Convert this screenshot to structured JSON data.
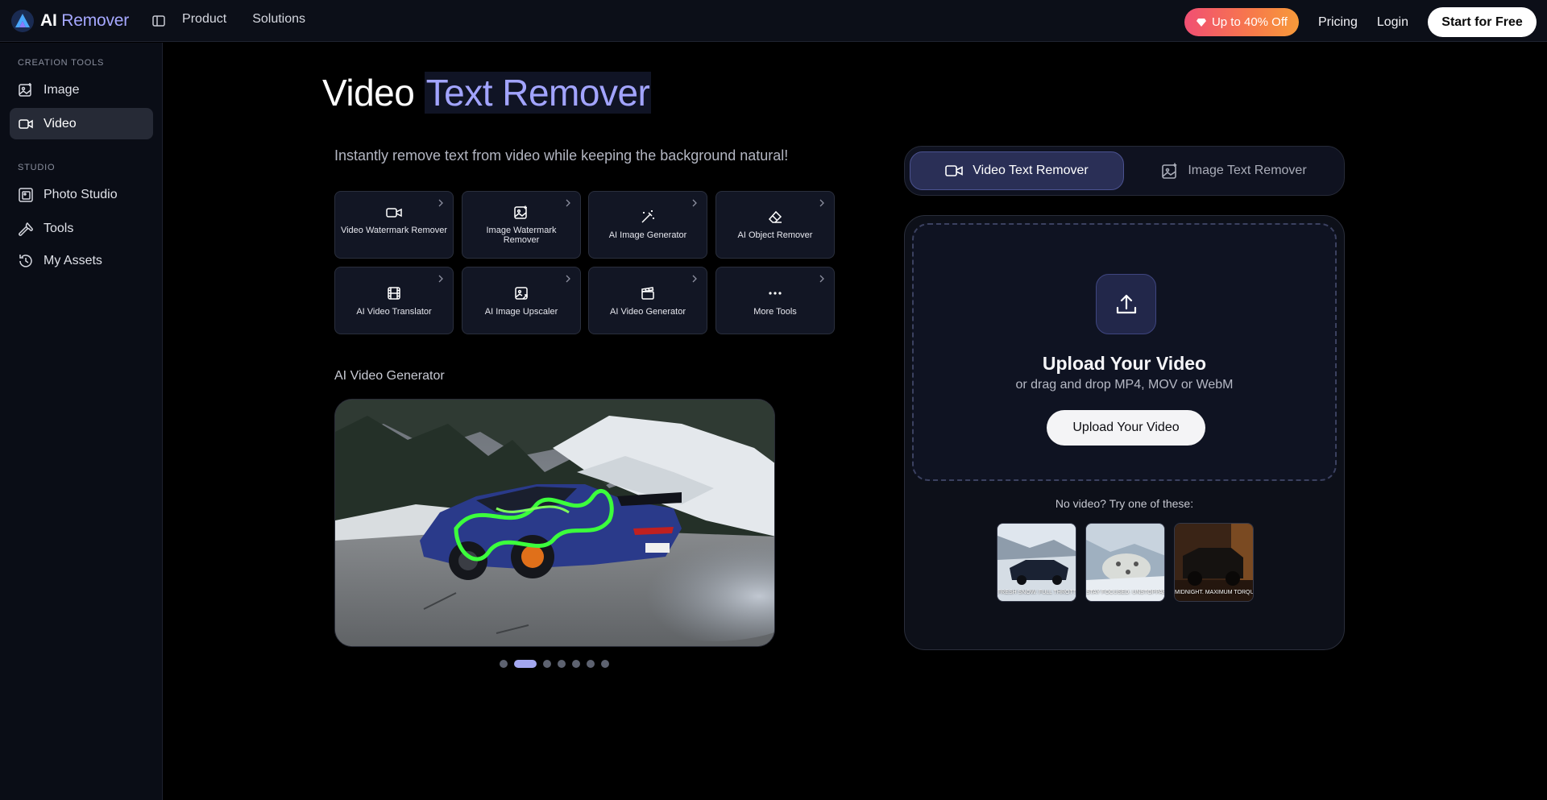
{
  "header": {
    "logo": {
      "ai": "AI",
      "remover": "Remover"
    },
    "nav": [
      "Product",
      "Solutions"
    ],
    "promo_label": "Up to 40% Off",
    "pricing_label": "Pricing",
    "login_label": "Login",
    "cta_label": "Start for Free"
  },
  "sidebar": {
    "section_creation": "CREATION TOOLS",
    "item_image": "Image",
    "item_video": "Video",
    "section_studio": "STUDIO",
    "item_photo_studio": "Photo Studio",
    "item_tools": "Tools",
    "item_assets": "My Assets",
    "active_item": "Video"
  },
  "main": {
    "title_part1": "Video",
    "title_accent": "Text Remover",
    "subtitle": "Instantly remove text from video while keeping the background natural!",
    "tools": [
      {
        "label": "Video Watermark Remover",
        "icon": "video-camera-icon"
      },
      {
        "label": "Image Watermark Remover",
        "icon": "image-icon"
      },
      {
        "label": "AI Image Generator",
        "icon": "magic-wand-icon"
      },
      {
        "label": "AI Object Remover",
        "icon": "eraser-icon"
      },
      {
        "label": "AI Video Translator",
        "icon": "film-icon"
      },
      {
        "label": "AI Image Upscaler",
        "icon": "image-upscale-icon"
      },
      {
        "label": "AI Video Generator",
        "icon": "clapperboard-icon"
      },
      {
        "label": "More Tools",
        "icon": "more-dots-icon"
      }
    ],
    "showcase_label": "AI Video Generator",
    "carousel": {
      "count": 7,
      "active_index": 1
    }
  },
  "panel": {
    "tab_video": "Video Text Remover",
    "tab_image": "Image Text Remover",
    "active_tab": "Video Text Remover",
    "upload_title": "Upload Your Video",
    "upload_sub": "or drag and drop MP4, MOV or WebM",
    "upload_button": "Upload Your Video",
    "samples_label": "No video? Try one of these:",
    "samples": [
      {
        "caption": "FRESH SNOW. FULL THROTTLE"
      },
      {
        "caption": "STAY FOCUSED. UNSTOPPABLE"
      },
      {
        "caption": "MIDNIGHT. MAXIMUM TORQUE"
      }
    ]
  },
  "colors": {
    "accent": "#a2a4ff",
    "background": "#000000",
    "promo_gradient": [
      "#f14f73",
      "#f79a3a"
    ]
  }
}
